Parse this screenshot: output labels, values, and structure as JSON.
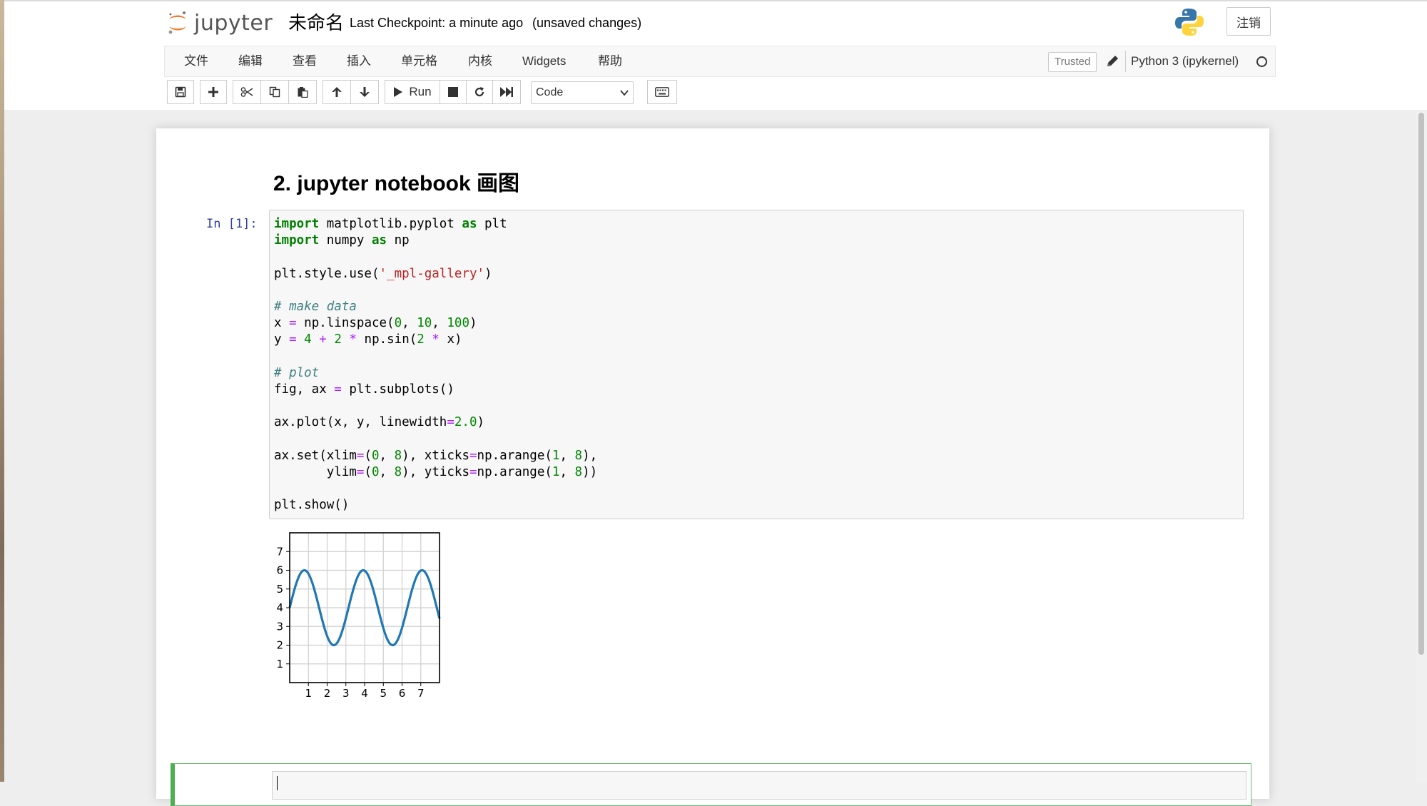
{
  "header": {
    "logo_text": "jupyter",
    "notebook_name": "未命名",
    "checkpoint": "Last Checkpoint: a minute ago",
    "unsaved": "(unsaved changes)",
    "logout_label": "注销"
  },
  "menubar": {
    "items": [
      "文件",
      "编辑",
      "查看",
      "插入",
      "单元格",
      "内核",
      "Widgets",
      "帮助"
    ],
    "trusted_label": "Trusted",
    "kernel_name": "Python 3 (ipykernel)"
  },
  "toolbar": {
    "run_label": "Run",
    "cell_type": "Code",
    "icons": [
      "save-icon",
      "plus-icon",
      "cut-icon",
      "copy-icon",
      "paste-icon",
      "arrow-up-icon",
      "arrow-down-icon",
      "play-icon",
      "stop-icon",
      "restart-icon",
      "fast-forward-icon",
      "keyboard-icon"
    ]
  },
  "notebook": {
    "heading": "2. jupyter notebook 画图",
    "cell_prompt": "In [1]:",
    "code_lines": [
      "import matplotlib.pyplot as plt",
      "import numpy as np",
      "",
      "plt.style.use('_mpl-gallery')",
      "",
      "# make data",
      "x = np.linspace(0, 10, 100)",
      "y = 4 + 2 * np.sin(2 * x)",
      "",
      "# plot",
      "fig, ax = plt.subplots()",
      "",
      "ax.plot(x, y, linewidth=2.0)",
      "",
      "ax.set(xlim=(0, 8), xticks=np.arange(1, 8),",
      "       ylim=(0, 8), yticks=np.arange(1, 8))",
      "",
      "plt.show()"
    ]
  },
  "chart_data": {
    "type": "line",
    "function": "y = 4 + 2 * sin(2 * x)",
    "x": [
      0.0,
      0.2,
      0.4,
      0.6,
      0.8,
      1.0,
      1.2,
      1.4,
      1.6,
      1.8,
      2.0,
      2.2,
      2.4,
      2.6,
      2.8,
      3.0,
      3.2,
      3.4,
      3.6,
      3.8,
      4.0,
      4.2,
      4.4,
      4.6,
      4.8,
      5.0,
      5.2,
      5.4,
      5.6,
      5.8,
      6.0,
      6.2,
      6.4,
      6.6,
      6.8,
      7.0,
      7.2,
      7.4,
      7.6,
      7.8,
      8.0
    ],
    "y": [
      4.0,
      4.78,
      5.43,
      5.86,
      6.0,
      5.82,
      5.35,
      4.67,
      3.88,
      3.11,
      2.49,
      2.09,
      2.01,
      2.23,
      2.73,
      3.44,
      4.23,
      4.98,
      5.59,
      5.96,
      5.98,
      5.71,
      5.2,
      4.51,
      3.71,
      2.96,
      2.35,
      2.03,
      2.04,
      2.4,
      2.93,
      3.6,
      4.42,
      5.14,
      5.7,
      5.98,
      5.94,
      5.61,
      5.02,
      4.27,
      3.52
    ],
    "xlim": [
      0,
      8
    ],
    "ylim": [
      0,
      8
    ],
    "xticks": [
      "1",
      "2",
      "3",
      "4",
      "5",
      "6",
      "7"
    ],
    "yticks": [
      "1",
      "2",
      "3",
      "4",
      "5",
      "6",
      "7"
    ],
    "grid": true,
    "line_color": "#1f77b4"
  },
  "colors": {
    "prompt": "#303F9F",
    "keyword": "#008000",
    "string": "#BA2121",
    "comment": "#408080",
    "operator": "#AA22FF",
    "selected_cell": "#4caf50"
  }
}
